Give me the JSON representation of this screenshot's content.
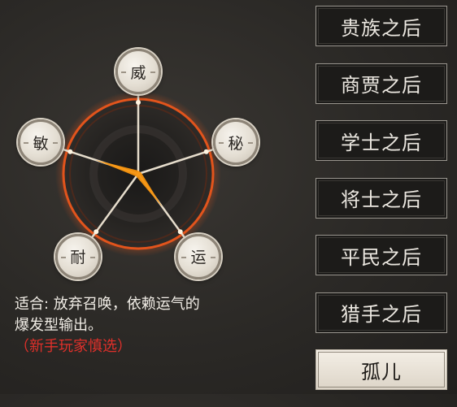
{
  "stats": {
    "wei": "威",
    "mi": "秘",
    "yun": "运",
    "nai": "耐",
    "min": "敏"
  },
  "stat_values": {
    "wei": 0.0,
    "mi": 0.0,
    "yun": 0.55,
    "nai": 0.0,
    "min": 0.6
  },
  "description": {
    "line1": "适合: 放弃召唤，依赖运气的",
    "line2": "爆发型输出。",
    "note": "（新手玩家慎选）"
  },
  "origins": [
    {
      "label": "贵族之后"
    },
    {
      "label": "商贾之后"
    },
    {
      "label": "学士之后"
    },
    {
      "label": "将士之后"
    },
    {
      "label": "平民之后"
    },
    {
      "label": "猎手之后"
    },
    {
      "label": "孤儿"
    }
  ],
  "selected_origin": "孤儿",
  "colors": {
    "radar_fill": "#f7930e",
    "ring_glow": "#e2541c",
    "note_red": "#e0302a"
  }
}
